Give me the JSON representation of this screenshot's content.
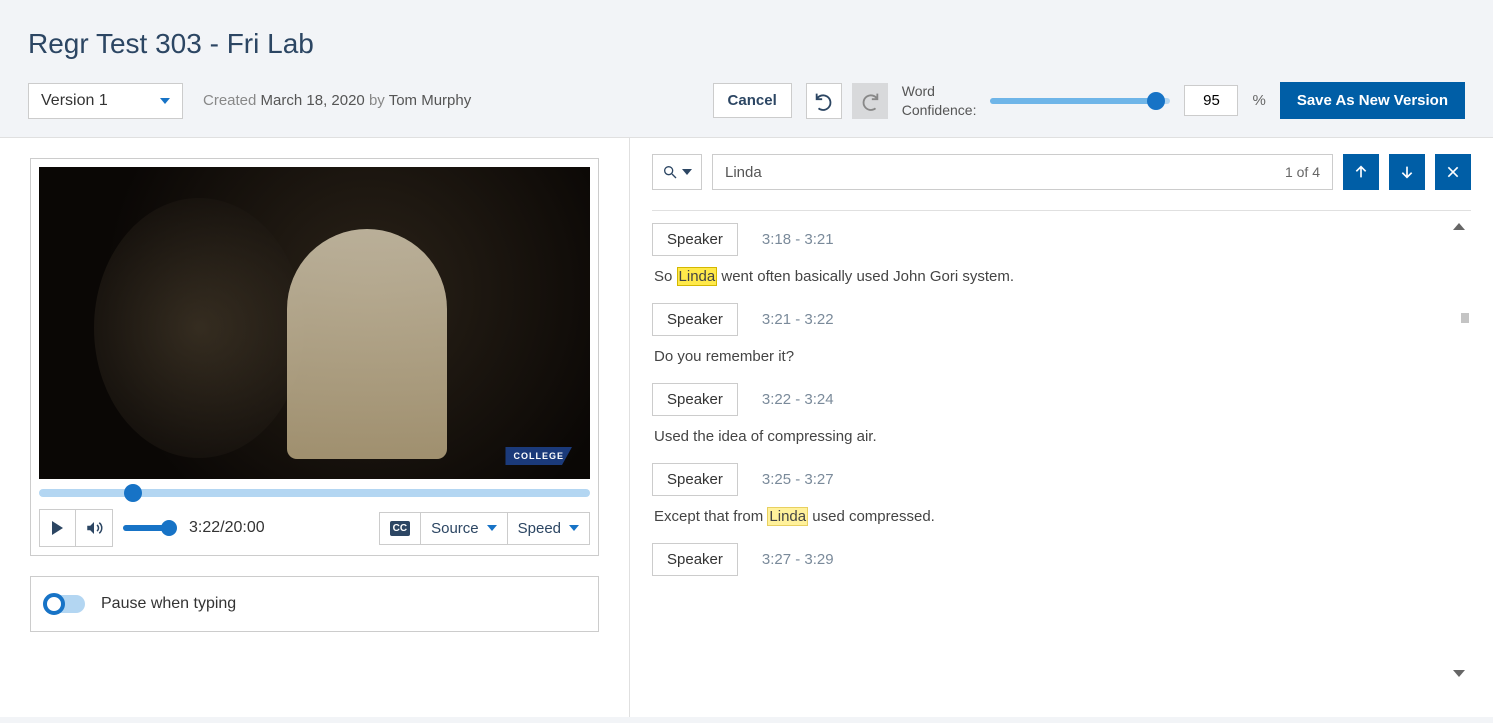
{
  "header": {
    "title": "Regr Test 303 - Fri Lab"
  },
  "version": {
    "selected": "Version 1"
  },
  "created": {
    "prefix": "Created ",
    "date": "March 18, 2020",
    "by": " by ",
    "author": "Tom Murphy"
  },
  "toolbar": {
    "cancel": "Cancel",
    "confidence_label_line1": "Word",
    "confidence_label_line2": "Confidence:",
    "confidence_value": "95",
    "percent": "%",
    "save": "Save As New Version"
  },
  "video": {
    "badge": "COLLEGE",
    "progress_percent": 17,
    "current_time": "3:22",
    "total_time": "20:00",
    "cc_label": "CC",
    "source_label": "Source",
    "speed_label": "Speed"
  },
  "pause_typing": {
    "label": "Pause when typing"
  },
  "search": {
    "query": "Linda",
    "count": "1 of 4"
  },
  "transcript": [
    {
      "speaker": "Speaker",
      "time": "3:18 - 3:21",
      "pre": "So ",
      "hl": "Linda",
      "post": " went often basically used John Gori system.",
      "current": true
    },
    {
      "speaker": "Speaker",
      "time": "3:21 - 3:22",
      "text": "Do you remember it?"
    },
    {
      "speaker": "Speaker",
      "time": "3:22 - 3:24",
      "text": "Used the idea of compressing air."
    },
    {
      "speaker": "Speaker",
      "time": "3:25 - 3:27",
      "pre": "Except that from ",
      "hl": "Linda",
      "post": " used compressed.",
      "current": false
    },
    {
      "speaker": "Speaker",
      "time": "3:27 - 3:29",
      "text": ""
    }
  ]
}
